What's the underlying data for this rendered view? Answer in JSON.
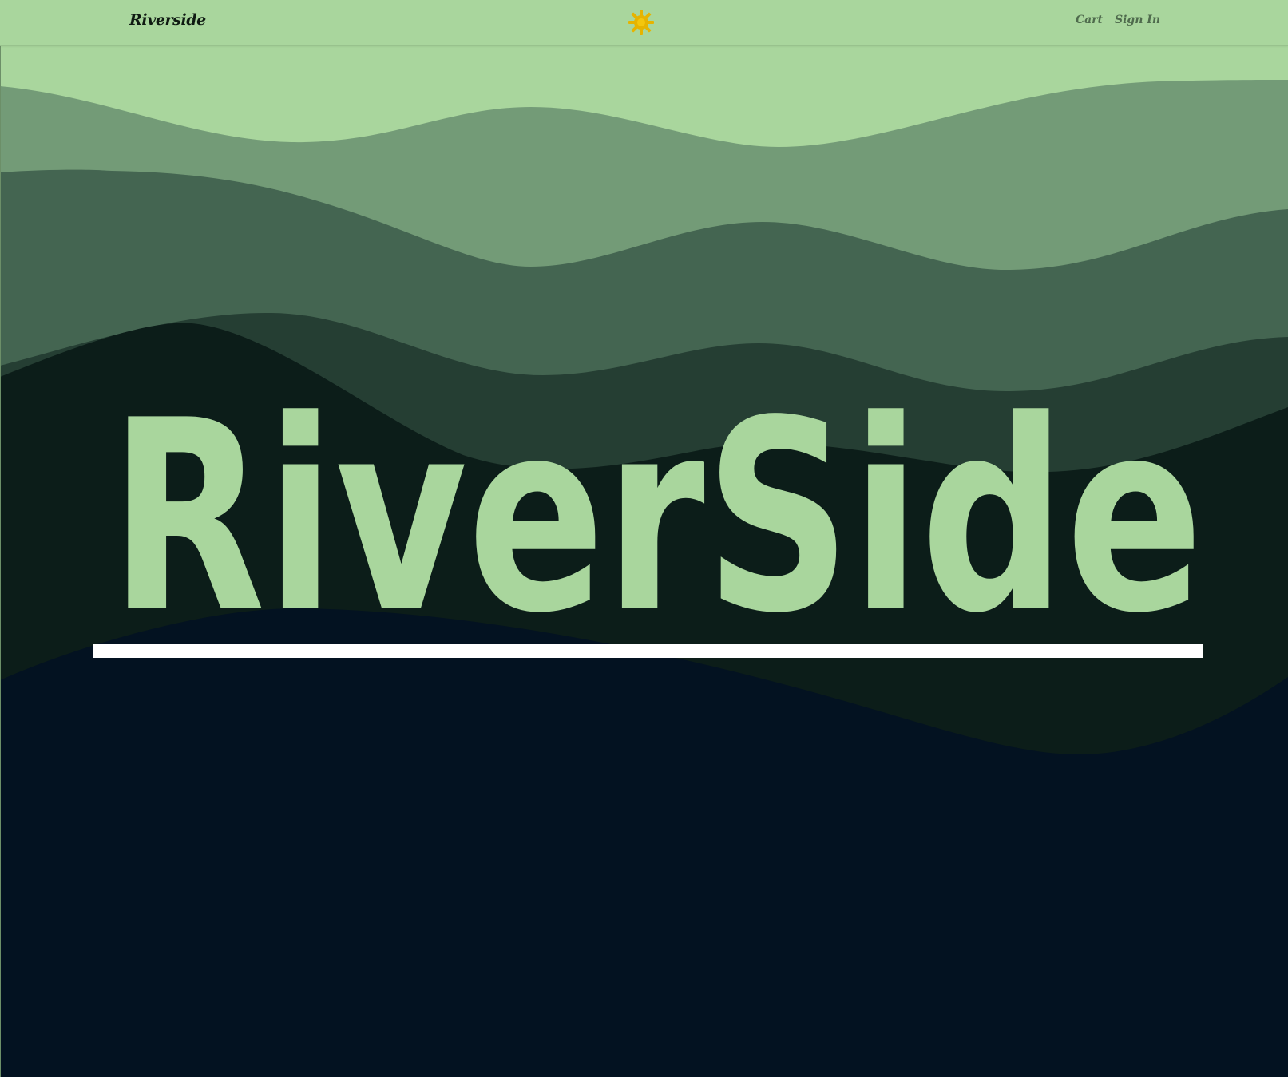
{
  "nav": {
    "brand": "Riverside",
    "theme_icon": "sun-icon",
    "links": [
      {
        "label": "Cart"
      },
      {
        "label": "Sign In"
      }
    ]
  },
  "hero": {
    "title": "RiverSide"
  },
  "colors": {
    "nav_bg": "#a9d69d",
    "hero_text": "#a9d69d",
    "sun": "#e6b400",
    "wave_layers": [
      "#a9d69d",
      "#739b77",
      "#446551",
      "#253e33",
      "#0c1d19",
      "#031221"
    ],
    "rule": "#ffffff"
  }
}
